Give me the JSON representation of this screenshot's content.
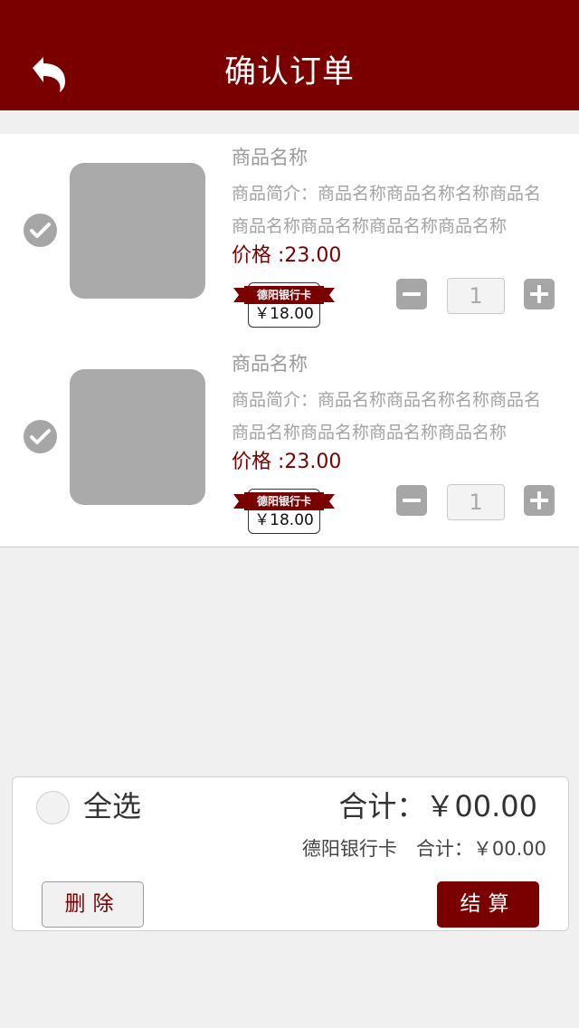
{
  "header": {
    "title": "确认订单",
    "back_icon": "back-arrow-icon",
    "background_color": "#7a0000"
  },
  "items": [
    {
      "name": "商品名称",
      "desc_line1": "商品简介：商品名称商品名称名称商品名",
      "desc_line2": "商品名称商品名称商品名称商品名称",
      "price": "价格 :23.00",
      "badge_label": "德阳银行卡",
      "badge_amount": "￥18.00",
      "quantity": "1",
      "checked": true
    },
    {
      "name": "商品名称",
      "desc_line1": "商品简介：商品名称商品名称名称商品名",
      "desc_line2": "商品名称商品名称商品名称商品名称",
      "price": "价格 :23.00",
      "badge_label": "德阳银行卡",
      "badge_amount": "￥18.00",
      "quantity": "1",
      "checked": true
    }
  ],
  "footer": {
    "select_all_label": "全选",
    "total": "合计：￥00.00",
    "card_total": "德阳银行卡　合计：￥00.00",
    "delete_label": "删除",
    "checkout_label": "结算"
  }
}
